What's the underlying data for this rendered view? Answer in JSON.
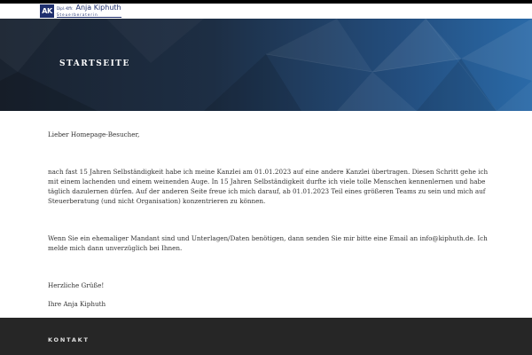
{
  "header": {
    "logo": {
      "mark": "AK",
      "prefix": "Dipl.-Kffr.",
      "name": "Anja Kiphuth",
      "subtitle": "Steuerberaterin"
    }
  },
  "hero": {
    "title": "STARTSEITE"
  },
  "content": {
    "greeting": "Lieber Homepage-Besucher,",
    "paragraph1": "nach fast 15 Jahren Selbständigkeit habe ich meine Kanzlei am 01.01.2023 auf eine andere Kanzlei übertragen. Diesen Schritt gehe ich mit einem lachenden und einem weinenden Auge. In 15 Jahren Selbständigkeit durfte ich viele tolle Menschen kennenlernen und habe täglich dazulernen dürfen. Auf der anderen Seite freue ich mich darauf, ab 01.01.2023 Teil eines größeren Teams zu sein und mich auf Steuerberatung (und nicht Organisation) konzentrieren zu können.",
    "paragraph2": "Wenn Sie ein ehemaliger Mandant sind und Unterlagen/Daten benötigen, dann senden Sie mir bitte eine Email an info@kiphuth.de. Ich melde mich dann unverzüglich bei Ihnen.",
    "closing": "Herzliche Grüße!",
    "signature": "Ihre Anja Kiphuth"
  },
  "footer": {
    "title": "KONTAKT"
  }
}
